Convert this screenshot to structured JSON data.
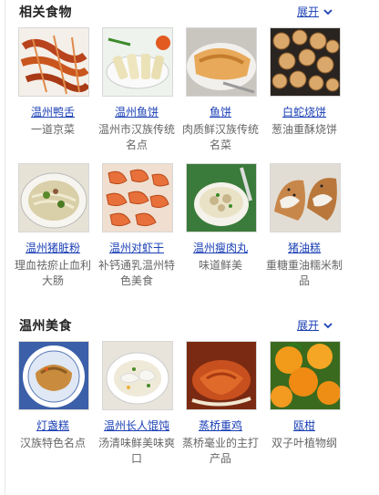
{
  "related": {
    "title": "相关食物",
    "expand_label": "展开",
    "items": [
      {
        "name": "温州鸭舌",
        "desc": "一道京菜"
      },
      {
        "name": "温州鱼饼",
        "desc": "温州市汉族传统名点"
      },
      {
        "name": "鱼饼",
        "desc": "肉质鲜汉族传统名菜"
      },
      {
        "name": "白蛇烧饼",
        "desc": "葱油重酥烧饼"
      },
      {
        "name": "温州猪脏粉",
        "desc": "理血祛瘀止血利大肠"
      },
      {
        "name": "温州对虾干",
        "desc": "补钙通乳温州特色美食"
      },
      {
        "name": "温州瘦肉丸",
        "desc": "味道鲜美"
      },
      {
        "name": "猪油糕",
        "desc": "重糖重油糯米制品"
      }
    ]
  },
  "wenzhou_food": {
    "title": "温州美食",
    "expand_label": "展开",
    "items": [
      {
        "name": "灯盏糕",
        "desc": "汉族特色名点"
      },
      {
        "name": "温州长人馄饨",
        "desc": "汤清味鲜美味爽口"
      },
      {
        "name": "蒸桥重鸡",
        "desc": "蒸桥毫业的主打产品"
      },
      {
        "name": "瓯柑",
        "desc": "双子叶植物纲"
      }
    ]
  },
  "colors": {
    "link": "#1a3fb5",
    "desc": "#666666",
    "title": "#222222"
  },
  "icons": {
    "expand": "chevron-down-icon"
  }
}
